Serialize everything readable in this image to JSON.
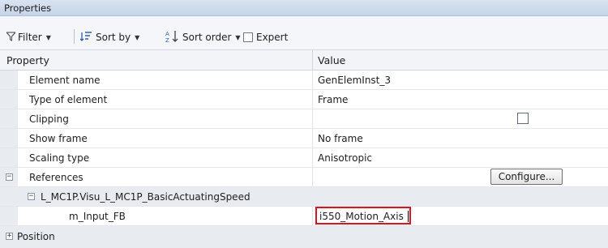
{
  "panel": {
    "title": "Properties"
  },
  "toolbar": {
    "filter_label": "Filter",
    "sort_by_label": "Sort by",
    "sort_order_label": "Sort order",
    "expert_label": "Expert",
    "expert_checked": false
  },
  "table": {
    "columns": [
      "Property",
      "Value"
    ],
    "rows": [
      {
        "name": "Element name",
        "value": "GenElemInst_3"
      },
      {
        "name": "Type of element",
        "value": "Frame"
      },
      {
        "name": "Clipping",
        "value": "",
        "checkbox": false
      },
      {
        "name": "Show frame",
        "value": "No frame"
      },
      {
        "name": "Scaling type",
        "value": "Anisotropic"
      },
      {
        "name": "References",
        "button": "Configure..."
      },
      {
        "name": "L_MC1P.Visu_L_MC1P_BasicActuatingSpeed"
      },
      {
        "name": "m_Input_FB",
        "value": "i550_Motion_Axis"
      },
      {
        "name": "Position"
      }
    ]
  },
  "colors": {
    "highlight_border": "#d4181f",
    "title_bg": "#cfdbed",
    "gutter_bg": "#e8ebf0"
  },
  "icons": [
    "filter-icon",
    "sort-by-icon",
    "sort-order-icon",
    "expand-icon",
    "collapse-icon"
  ]
}
